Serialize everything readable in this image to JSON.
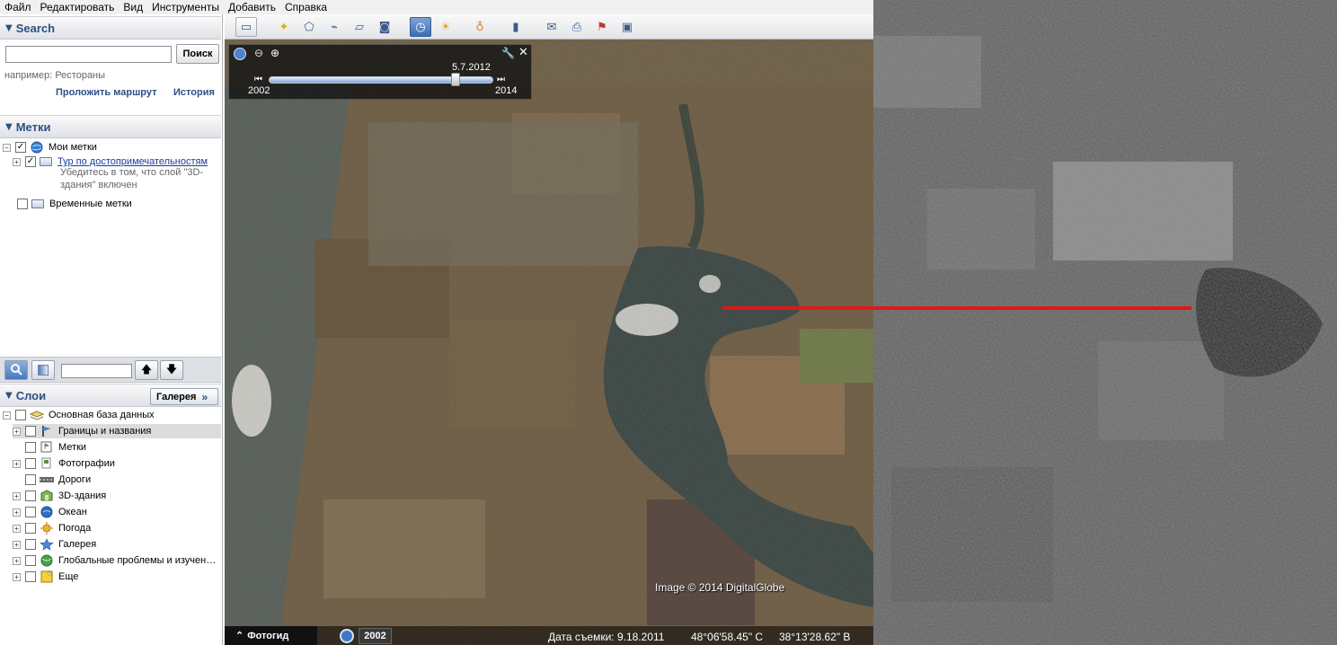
{
  "menu": [
    "Файл",
    "Редактировать",
    "Вид",
    "Инструменты",
    "Добавить",
    "Справка"
  ],
  "search": {
    "title": "Search",
    "button": "Поиск",
    "input_value": "",
    "hint": "например: Рестораны",
    "route_link": "Проложить маршрут",
    "history_link": "История"
  },
  "places": {
    "title": "Метки",
    "my_places": "Мои метки",
    "tour": "Тур по достопримечательностям",
    "tour_desc_1": "Убедитесь в том, что слой \"3D-",
    "tour_desc_2": "здания\" включен",
    "temp": "Временные метки"
  },
  "layers": {
    "title": "Слои",
    "gallery_button": "Галерея",
    "primary_db": "Основная база данных",
    "items": [
      {
        "label": "Границы и названия",
        "icon": "borders-icon"
      },
      {
        "label": "Метки",
        "icon": "placemark-icon"
      },
      {
        "label": "Фотографии",
        "icon": "photo-icon"
      },
      {
        "label": "Дороги",
        "icon": "road-icon"
      },
      {
        "label": "3D-здания",
        "icon": "building-icon"
      },
      {
        "label": "Океан",
        "icon": "ocean-icon"
      },
      {
        "label": "Погода",
        "icon": "weather-icon"
      },
      {
        "label": "Галерея",
        "icon": "gallery-star-icon"
      },
      {
        "label": "Глобальные проблемы и изучен…",
        "icon": "globe-icon"
      },
      {
        "label": "Еще",
        "icon": "more-icon"
      }
    ]
  },
  "timeslider": {
    "current_date": "5.7.2012",
    "start_year": "2002",
    "end_year": "2014",
    "position_fraction": 0.83
  },
  "map": {
    "copyright": "Image © 2014 DigitalGlobe",
    "capture_date": "Дата съемки: 9.18.2011",
    "lat": "48°06'58.45\" С",
    "lon": "38°13'28.62\" В",
    "tour_guide": "Фотогид",
    "year_badge": "2002"
  },
  "colors": {
    "accent": "#2e4f86",
    "red_line": "#e01818"
  }
}
